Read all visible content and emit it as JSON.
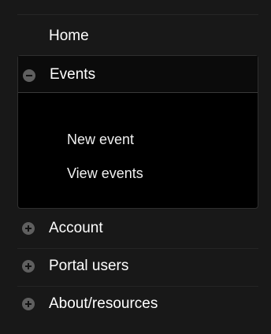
{
  "nav": {
    "home": "Home",
    "events": {
      "label": "Events",
      "icon": "minus-circle-icon",
      "subitems": [
        "New event",
        "View events"
      ]
    },
    "items": [
      {
        "label": "Account",
        "icon": "plus-circle-icon"
      },
      {
        "label": "Portal users",
        "icon": "plus-circle-icon"
      },
      {
        "label": "About/resources",
        "icon": "plus-circle-icon"
      }
    ]
  },
  "colors": {
    "background": "#181818",
    "panel": "#000000",
    "text": "#ffffff",
    "icon": "#5f5f5f"
  }
}
